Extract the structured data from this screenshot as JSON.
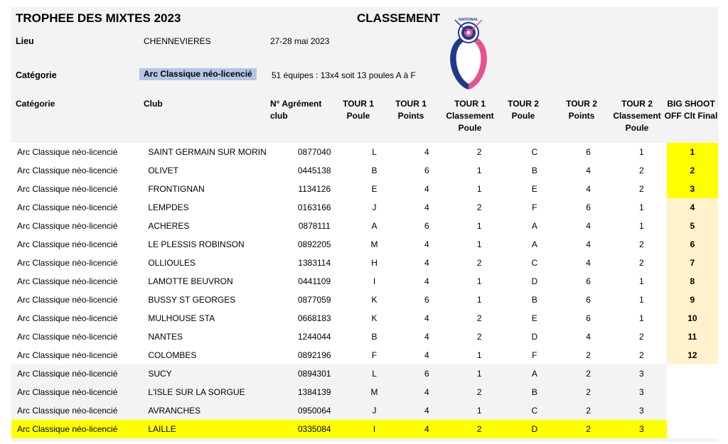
{
  "header": {
    "title": "TROPHEE DES MIXTES 2023",
    "classement": "CLASSEMENT",
    "lieu_label": "Lieu",
    "lieu_value": "CHENNEVIERES",
    "dates": "27-28 mai 2023",
    "categorie_label": "Catégorie",
    "categorie_value": "Arc Classique néo-licencié",
    "equipes_info": "51 équipes : 13x4 soit 13 poules  A à F"
  },
  "logo": {
    "text": "NATIONAL",
    "icon": "archery-target-twin-heads-logo"
  },
  "columns": [
    [
      "Catégorie"
    ],
    [
      "Club"
    ],
    [
      "N° Agrément",
      "club"
    ],
    [
      "TOUR 1",
      "Poule"
    ],
    [
      "TOUR 1",
      "Points"
    ],
    [
      "TOUR 1",
      "Classement",
      "Poule"
    ],
    [
      "TOUR 2",
      "Poule"
    ],
    [
      "TOUR 2",
      "Points"
    ],
    [
      "TOUR 2",
      "Classement",
      "Poule"
    ],
    [
      "BIG SHOOT",
      "OFF Clt Final"
    ]
  ],
  "rows": [
    {
      "cat": "Arc Classique néo-licencié",
      "club": "SAINT GERMAIN SUR MORIN",
      "agr": "0877040",
      "p1": "L",
      "pt1": "4",
      "cl1": "2",
      "p2": "C",
      "pt2": "6",
      "cl2": "1",
      "fin": "1"
    },
    {
      "cat": "Arc Classique néo-licencié",
      "club": "OLIVET",
      "agr": "0445138",
      "p1": "B",
      "pt1": "6",
      "cl1": "1",
      "p2": "B",
      "pt2": "4",
      "cl2": "2",
      "fin": "2"
    },
    {
      "cat": "Arc Classique néo-licencié",
      "club": "FRONTIGNAN",
      "agr": "1134126",
      "p1": "E",
      "pt1": "4",
      "cl1": "1",
      "p2": "E",
      "pt2": "4",
      "cl2": "2",
      "fin": "3"
    },
    {
      "cat": "Arc Classique néo-licencié",
      "club": "LEMPDES",
      "agr": "0163166",
      "p1": "J",
      "pt1": "4",
      "cl1": "2",
      "p2": "F",
      "pt2": "6",
      "cl2": "1",
      "fin": "4"
    },
    {
      "cat": "Arc Classique néo-licencié",
      "club": "ACHERES",
      "agr": "0878111",
      "p1": "A",
      "pt1": "6",
      "cl1": "1",
      "p2": "A",
      "pt2": "4",
      "cl2": "1",
      "fin": "5"
    },
    {
      "cat": "Arc Classique néo-licencié",
      "club": "LE PLESSIS ROBINSON",
      "agr": "0892205",
      "p1": "M",
      "pt1": "4",
      "cl1": "1",
      "p2": "A",
      "pt2": "4",
      "cl2": "2",
      "fin": "6"
    },
    {
      "cat": "Arc Classique néo-licencié",
      "club": "OLLIOULES",
      "agr": "1383114",
      "p1": "H",
      "pt1": "4",
      "cl1": "2",
      "p2": "C",
      "pt2": "4",
      "cl2": "2",
      "fin": "7"
    },
    {
      "cat": "Arc Classique néo-licencié",
      "club": "LAMOTTE BEUVRON",
      "agr": "0441109",
      "p1": "I",
      "pt1": "4",
      "cl1": "1",
      "p2": "D",
      "pt2": "6",
      "cl2": "1",
      "fin": "8"
    },
    {
      "cat": "Arc Classique néo-licencié",
      "club": "BUSSY ST GEORGES",
      "agr": "0877059",
      "p1": "K",
      "pt1": "6",
      "cl1": "1",
      "p2": "B",
      "pt2": "6",
      "cl2": "1",
      "fin": "9"
    },
    {
      "cat": "Arc Classique néo-licencié",
      "club": "MULHOUSE STA",
      "agr": "0668183",
      "p1": "K",
      "pt1": "4",
      "cl1": "2",
      "p2": "E",
      "pt2": "6",
      "cl2": "1",
      "fin": "10"
    },
    {
      "cat": "Arc Classique néo-licencié",
      "club": "NANTES",
      "agr": "1244044",
      "p1": "B",
      "pt1": "4",
      "cl1": "2",
      "p2": "D",
      "pt2": "4",
      "cl2": "2",
      "fin": "11"
    },
    {
      "cat": "Arc Classique néo-licencié",
      "club": "COLOMBES",
      "agr": "0892196",
      "p1": "F",
      "pt1": "4",
      "cl1": "1",
      "p2": "F",
      "pt2": "2",
      "cl2": "2",
      "fin": "12"
    },
    {
      "cat": "Arc Classique néo-licencié",
      "club": "SUCY",
      "agr": "0894301",
      "p1": "L",
      "pt1": "6",
      "cl1": "1",
      "p2": "A",
      "pt2": "2",
      "cl2": "3",
      "fin": ""
    },
    {
      "cat": "Arc Classique néo-licencié",
      "club": "L'ISLE SUR LA SORGUE",
      "agr": "1384139",
      "p1": "M",
      "pt1": "4",
      "cl1": "2",
      "p2": "B",
      "pt2": "2",
      "cl2": "3",
      "fin": ""
    },
    {
      "cat": "Arc Classique néo-licencié",
      "club": "AVRANCHES",
      "agr": "0950064",
      "p1": "J",
      "pt1": "4",
      "cl1": "1",
      "p2": "C",
      "pt2": "2",
      "cl2": "3",
      "fin": ""
    },
    {
      "cat": "Arc Classique néo-licencié",
      "club": "LAILLE",
      "agr": "0335084",
      "p1": "I",
      "pt1": "4",
      "cl1": "2",
      "p2": "D",
      "pt2": "2",
      "cl2": "3",
      "fin": ""
    }
  ],
  "colors": {
    "podium": "#ffff00",
    "ranked": "#fff2cc",
    "highlight_row": "#ffff00",
    "category_hl": "#b4c6e7"
  }
}
